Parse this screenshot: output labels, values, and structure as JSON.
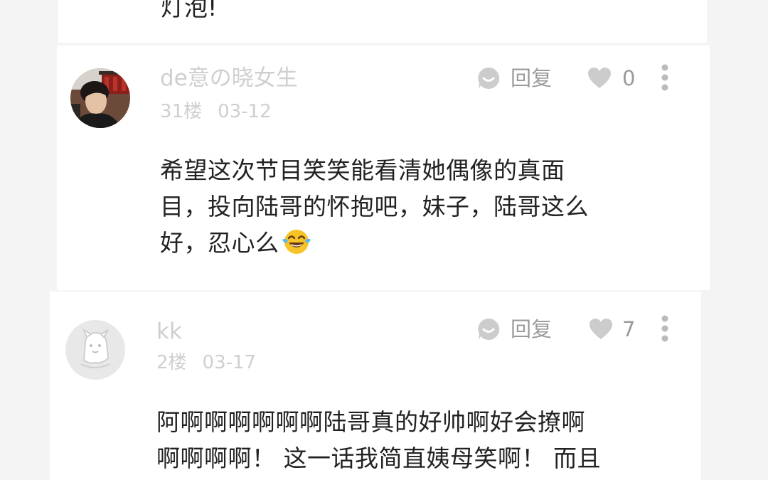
{
  "top_fragment": "灯泡!",
  "comments": [
    {
      "username": "de意の晓女生",
      "floor": "31楼",
      "date": "03-12",
      "reply_label": "回复",
      "likes": "0",
      "lines": [
        "希望这次节目笑笑能看清她偶像的真面",
        "目，投向陆哥的怀抱吧，妹子，陆哥这么",
        "好，忍心么"
      ],
      "emoji": "tears-of-joy-emoji"
    },
    {
      "username": "kk",
      "floor": "2楼",
      "date": "03-17",
      "reply_label": "回复",
      "likes": "7",
      "lines": [
        "阿啊啊啊啊啊啊陆哥真的好帅啊好会撩啊",
        "啊啊啊啊！ 这一话我简直姨母笑啊！ 而且"
      ]
    }
  ],
  "icons": {
    "reply": "reply-bubble-icon",
    "like": "heart-icon",
    "more": "more-vertical-icon"
  },
  "colors": {
    "username": "#cfcfcf",
    "meta": "#cfcfcf",
    "action": "#9a9a9a",
    "icon": "#cccccc",
    "text": "#222222"
  }
}
